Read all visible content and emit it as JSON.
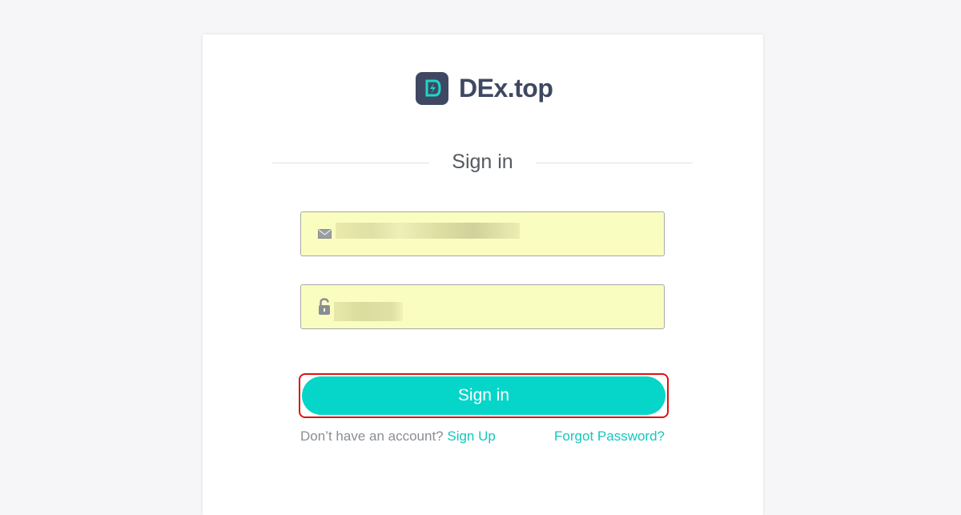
{
  "brand": {
    "name": "DEx.top",
    "mark_color": "#3f4862",
    "accent_color": "#06d6c9"
  },
  "form": {
    "title": "Sign in",
    "email": {
      "icon": "mail-icon",
      "value": ""
    },
    "password": {
      "icon": "lock-icon",
      "value": ""
    },
    "submit_label": "Sign in"
  },
  "footer": {
    "prompt": "Don’t have an account?",
    "signup_label": "Sign Up",
    "forgot_label": "Forgot Password?"
  },
  "colors": {
    "field_bg": "#fafdc0",
    "highlight_border": "#e01010",
    "link": "#14c7bd"
  }
}
